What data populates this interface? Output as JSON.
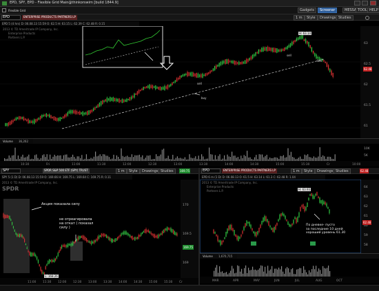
{
  "window": {
    "title": "EPD, SPY, EPD - Flexible Grid Main@thinkorswim [build 1844.9]",
    "grid_label": "Flexible Grid",
    "gadgets_label": "Gadgets",
    "screener_label": "Screener",
    "tools": [
      "MESSAGES",
      "TOOLS",
      "HELP"
    ]
  },
  "top_chart": {
    "symbol": "EPD",
    "company": "ENTERPRISE PRODUCTS PARTNERS LP",
    "quote": "EPD 5 (4 hrs)  D: 06.08.13 15:59  O: 62.5  H: 63.15  L: 62.39  C: 62.48  R: 0.15",
    "watermark": [
      "2013 © TD Ameritrade IP Company, Inc.",
      "Enterprise Products",
      "Partners L.P."
    ],
    "timeframe": "1 m",
    "style_label": "Style",
    "drawings_label": "Drawings",
    "studies_label": "Studies",
    "price_tag": "62.48",
    "high_label": "H: 63.14",
    "annotations": {
      "sell1": "sell",
      "sell2": "sell",
      "sell3": "Sell",
      "buy": "buy"
    },
    "y_ticks": [
      "63",
      "62.5",
      "62",
      "61.5",
      "61"
    ],
    "x_ticks": [
      "10:30",
      "Fri",
      "11:00",
      "11:30",
      "12:00",
      "12:30",
      "13:00",
      "13:30",
      "14:00",
      "14:30",
      "15:00",
      "15:30",
      "Cr",
      "10:00"
    ],
    "volume_label": "Volume",
    "volume_value": "36,262",
    "vol_ticks": [
      "10K",
      "5K"
    ]
  },
  "bottom_left": {
    "symbol": "SPY",
    "company": "SPDR S&P 500 ETF (SPY) TRUST",
    "quote": "SPY 5 (1 D)  D: 06.08.13 15:59  O: 169.66  H: 169.75  L: 169.64  C: 169.75  R: 0.11",
    "watermark": [
      "2013 © TD Ameritrade IP Company, Inc.",
      "SPDR"
    ],
    "timeframe": "1 m",
    "style_label": "Style",
    "drawings_label": "Drawings",
    "studies_label": "Studies",
    "price_tag": "169.75",
    "low_label": "L: 168.26",
    "annotation_1": "Акция показала силу",
    "annotation_2": "не отреагировала\nна откат ( показал\nсилу )",
    "y_ticks": [
      "170",
      "169.5",
      "169"
    ],
    "x_ticks": [
      "11:00",
      "11:30",
      "12:00",
      "12:30",
      "13:00",
      "13:30",
      "14:00",
      "14:30",
      "15:00",
      "15:30",
      "Cr"
    ]
  },
  "bottom_right": {
    "symbol": "EPD",
    "company": "ENTERPRISE PRODUCTS PARTNERS LP",
    "quote": "EPD 6 m (1 D)  D: 06.08.13  O: 61.5  H: 63.14  L: 61.3  C: 62.48  R: 1.04",
    "watermark": [
      "2013 © TD Ameritrade IP Company, Inc.",
      "Enterprise Products",
      "Partners L.P."
    ],
    "timeframe": "1 m",
    "style_label": "Style",
    "drawings_label": "Drawings",
    "studies_label": "Studies",
    "price_tag": "62.48",
    "high_label": "H: 63.93",
    "annotation": "По дневке- пусто\nза последние 10 дней\nхороший уровень 61.30",
    "y_ticks": [
      "64",
      "63",
      "62",
      "61",
      "60",
      "59",
      "58"
    ],
    "volume_label": "Volume",
    "volume_value": "1,670,715",
    "x_ticks": [
      "MAR",
      "APR",
      "MAY",
      "JUN",
      "JUL",
      "AUG",
      "OCT"
    ]
  },
  "colors": {
    "up": "#33cc44",
    "down": "#dd3333",
    "trend": "#cccccc",
    "accent": "#2d5d9a"
  }
}
